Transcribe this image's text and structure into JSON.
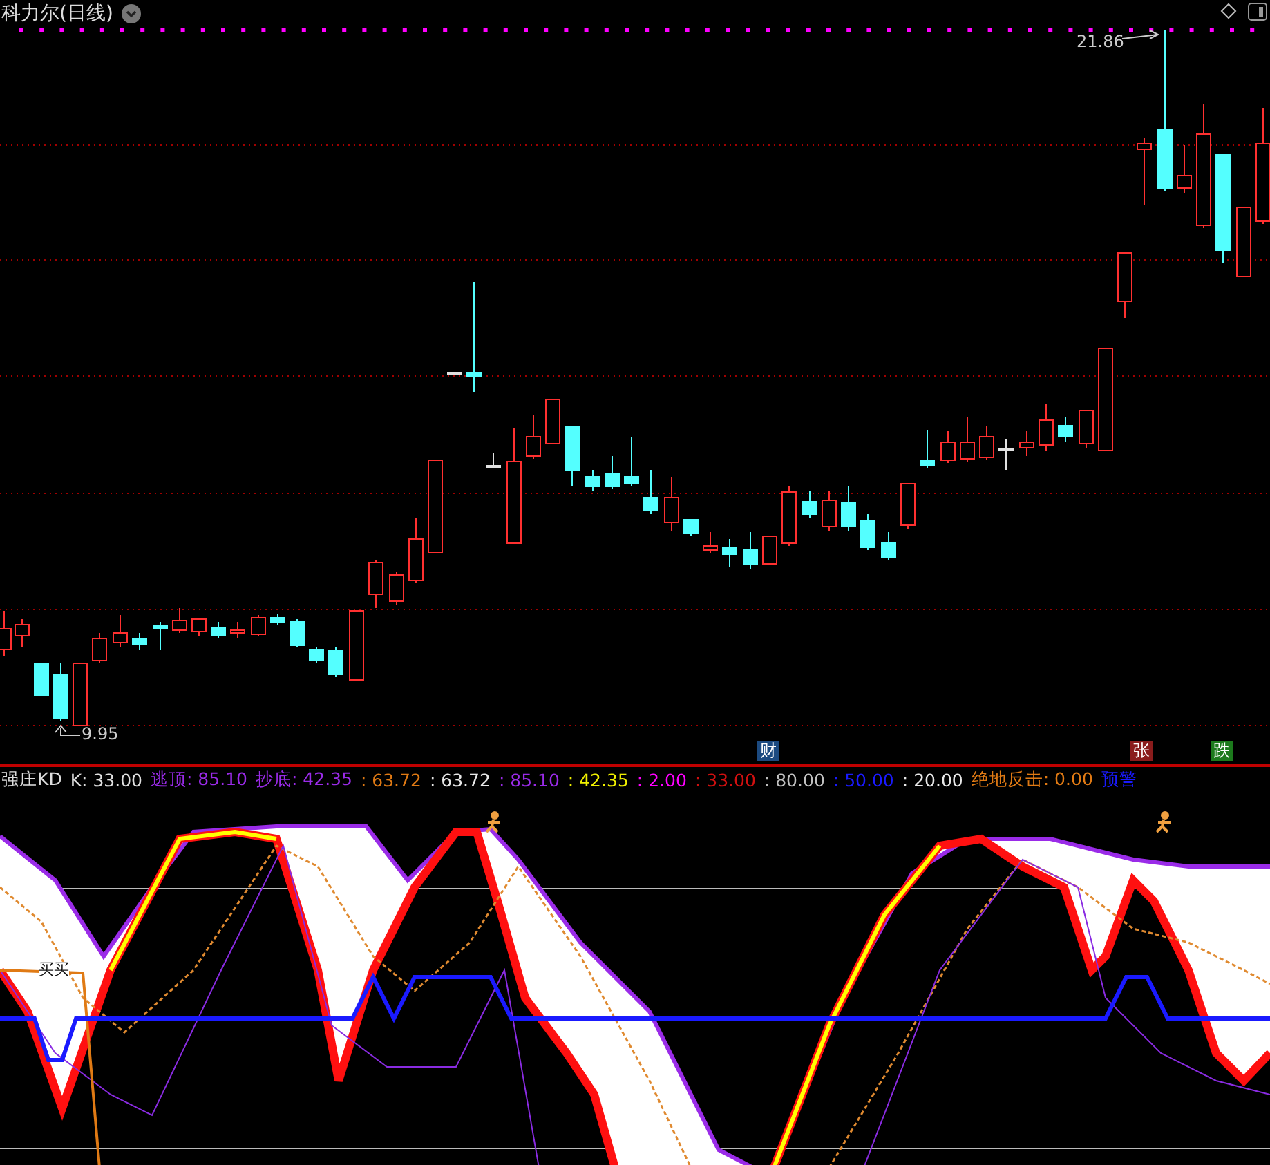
{
  "chart": {
    "title": "科力尔(日线)",
    "high_label": "21.86",
    "low_label": "9.95",
    "markers": [
      {
        "text": "财",
        "color": "#1c4a80"
      },
      {
        "text": "张",
        "color": "#8a1c1c"
      },
      {
        "text": "跌",
        "color": "#1c7a1c"
      }
    ]
  },
  "indicator": {
    "name": "强庄KD",
    "signal_label": "买买",
    "items": [
      {
        "text": "K: 33.00",
        "color": "#e0e0e0"
      },
      {
        "text": "逃顶: 85.10",
        "color": "#9a2be8"
      },
      {
        "text": "抄底: 42.35",
        "color": "#9a2be8"
      },
      {
        "text": ": 63.72",
        "color": "#e07a14"
      },
      {
        "text": ": 63.72",
        "color": "#e8e8e8"
      },
      {
        "text": ": 85.10",
        "color": "#9a2be8"
      },
      {
        "text": ": 42.35",
        "color": "#f0f000"
      },
      {
        "text": ": 2.00",
        "color": "#ff00ff"
      },
      {
        "text": ": 33.00",
        "color": "#d01010"
      },
      {
        "text": ": 80.00",
        "color": "#c0c0c0"
      },
      {
        "text": ": 50.00",
        "color": "#1a1aff"
      },
      {
        "text": ": 20.00",
        "color": "#e8e8e8"
      },
      {
        "text": "绝地反击: 0.00",
        "color": "#e07a14"
      },
      {
        "text": "预警",
        "color": "#1a1aff"
      }
    ]
  }
}
